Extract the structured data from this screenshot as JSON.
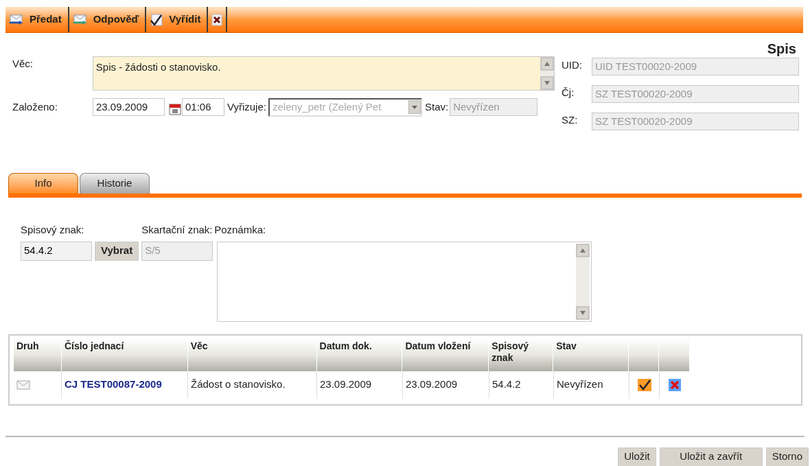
{
  "toolbar": [
    {
      "kind": "forward",
      "label": "Předat"
    },
    {
      "kind": "reply",
      "label": "Odpověď"
    },
    {
      "kind": "resolve",
      "label": "Vyřídit"
    },
    {
      "kind": "close"
    }
  ],
  "title": "Spis",
  "form": {
    "vec": {
      "label": "Věc:",
      "value": "Spis - žádosti o stanovisko."
    },
    "zalozeno": {
      "label": "Založeno:",
      "date": "23.09.2009",
      "time": "01:06"
    },
    "vyrizuje": {
      "label": "Vyřizuje:",
      "value": "zeleny_petr (Zelený Pet",
      "disabled": true
    },
    "stav": {
      "label": "Stav:",
      "value": "Nevyřízen",
      "disabled": true
    },
    "ids": [
      {
        "label": "UID:",
        "value": "UID TEST00020-2009",
        "disabled": true
      },
      {
        "label": "Čj:",
        "value": "SZ TEST00020-2009",
        "disabled": true
      },
      {
        "label": "SZ:",
        "value": "SZ TEST00020-2009",
        "disabled": true
      }
    ]
  },
  "tabs": [
    {
      "label": "Info",
      "selected": true
    },
    {
      "label": "Historie",
      "selected": false
    }
  ],
  "info": {
    "spisovy_znak": {
      "label": "Spisový znak:",
      "value": "54.4.2"
    },
    "vybrat": "Vybrat",
    "skartacni_znak": {
      "label": "Skartační znak:",
      "value": "S/5",
      "disabled": true
    },
    "poznamka": {
      "label": "Poznámka:"
    }
  },
  "table": {
    "columns": [
      "Druh",
      "Číslo jednací",
      "Věc",
      "Datum dok.",
      "Datum vložení",
      "Spisový znak",
      "Stav"
    ],
    "rows": [
      {
        "cislo": "CJ TEST00087-2009",
        "vec": "Žádost o stanovisko.",
        "datum_dok": "23.09.2009",
        "datum_vlozeni": "23.09.2009",
        "spisovy_znak": "54.4.2",
        "stav": "Nevyřízen"
      }
    ]
  },
  "buttons": [
    "Uložit",
    "Uložit a zavřít",
    "Storno"
  ]
}
